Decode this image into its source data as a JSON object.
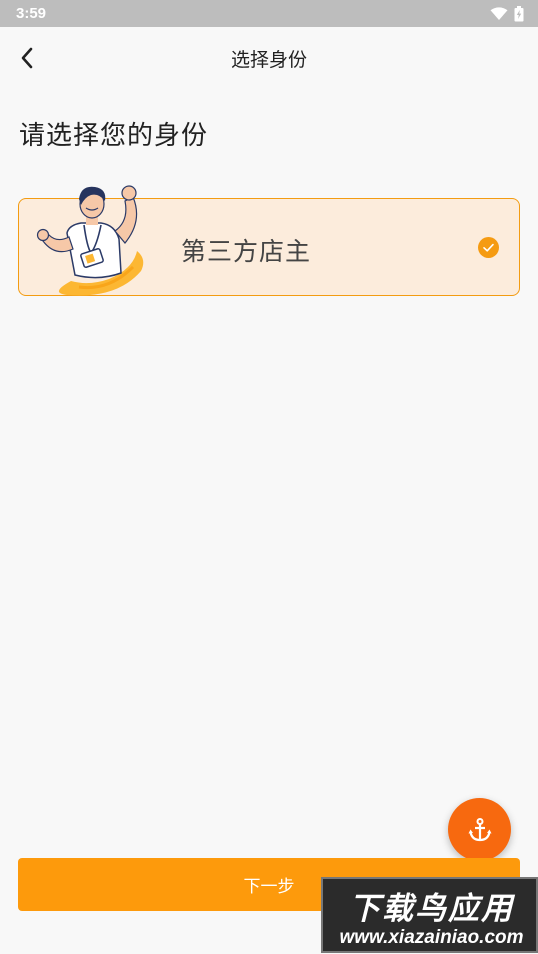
{
  "status_bar": {
    "time": "3:59",
    "icons": [
      "wifi-icon",
      "battery-charging-icon"
    ]
  },
  "nav": {
    "back_icon": "chevron-left-icon",
    "title": "选择身份"
  },
  "heading": "请选择您的身份",
  "roles": [
    {
      "label": "第三方店主",
      "selected": true,
      "illustration": "shopkeeper-illustration",
      "check_icon": "check-circle-icon"
    }
  ],
  "fab": {
    "icon": "anchor-icon"
  },
  "next_button": {
    "label": "下一步"
  },
  "watermark": {
    "title": "下载鸟应用",
    "url": "www.xiazainiao.com"
  },
  "colors": {
    "accent": "#fd9a0c",
    "card_bg": "#fcecdc",
    "card_border": "#f39c12",
    "fab": "#f7690f",
    "status_bar": "#bdbdbd",
    "background": "#f8f8f8"
  }
}
